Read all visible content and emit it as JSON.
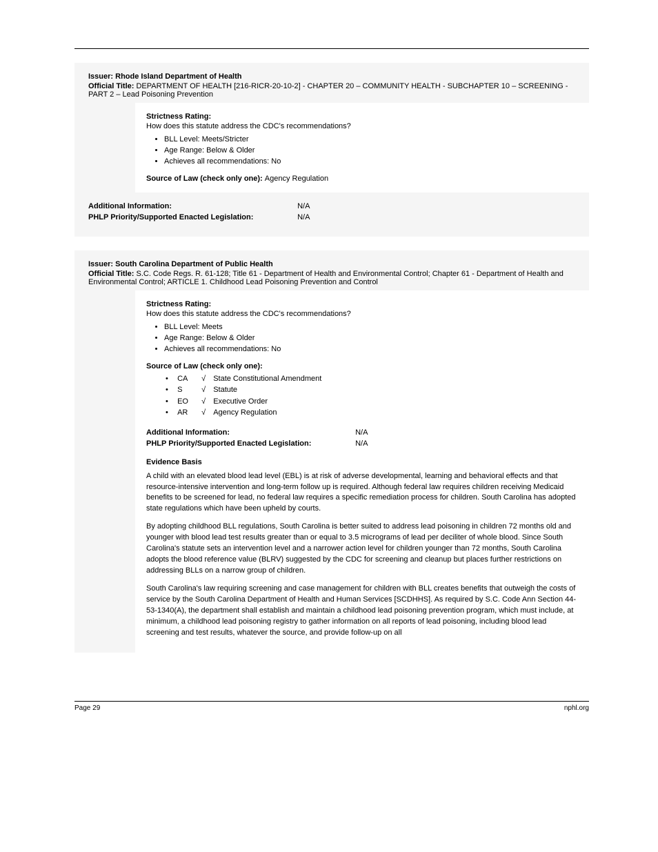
{
  "box1": {
    "issuer_label": "Issuer:",
    "issuer": "Rhode Island Department of Health",
    "title_label": "Official Title:",
    "title": "DEPARTMENT OF HEALTH [216-RICR-20-10-2] - CHAPTER 20 – COMMUNITY HEALTH - SUBCHAPTER 10 – SCREENING - PART 2 – Lead Poisoning Prevention",
    "rating_label": "Strictness Rating:",
    "rating_sub": "How does this statute address the CDC's recommendations?",
    "bullets": [
      "BLL Level: Meets/Stricter",
      "Age Range: Below & Older",
      "Achieves all recommendations: No"
    ],
    "source_label": "Source of Law (check only one):",
    "source_value": "Agency Regulation",
    "info_label": "Additional Information:",
    "info_value": "N/A",
    "act_label": "PHLP Priority/Supported Enacted Legislation:",
    "act_value": "N/A"
  },
  "box2": {
    "issuer_label": "Issuer:",
    "issuer": "South Carolina Department of Public Health",
    "title_label": "Official Title:",
    "title": "S.C. Code Regs. R. 61-128; Title 61 - Department of Health and Environmental Control; Chapter 61 - Department of Health and Environmental Control; ARTICLE 1. Childhood Lead Poisoning Prevention and Control",
    "rating_label": "Strictness Rating:",
    "rating_sub": "How does this statute address the CDC's recommendations?",
    "bullets": [
      "BLL Level: Meets",
      "Age Range: Below & Older",
      "Achieves all recommendations: No"
    ],
    "source_label": "Source of Law (check only one):",
    "sources": [
      {
        "code": "CA",
        "check": "√",
        "name": "State Constitutional Amendment"
      },
      {
        "code": "S",
        "check": "√",
        "name": "Statute"
      },
      {
        "code": "EO",
        "check": "√",
        "name": "Executive Order"
      },
      {
        "code": "AR",
        "check": "√",
        "name": "Agency Regulation"
      }
    ],
    "info_label": "Additional Information:",
    "info_value": "N/A",
    "act_label": "PHLP Priority/Supported Enacted Legislation:",
    "act_value": "N/A",
    "ev_title": "Evidence Basis",
    "ev_p1": "A child with an elevated blood lead level (EBL) is at risk of adverse developmental, learning and behavioral effects and that resource-intensive intervention and long-term follow up is required. Although federal law requires children receiving Medicaid benefits to be screened for lead, no federal law requires a specific remediation process for children. South Carolina has adopted state regulations which have been upheld by courts.",
    "ev_p2": "By adopting childhood BLL regulations, South Carolina is better suited to address lead poisoning in children 72 months old and younger with blood lead test results greater than or equal to 3.5 micrograms of lead per deciliter of whole blood. Since South Carolina's statute sets an intervention level and a narrower action level for children younger than 72 months, South Carolina adopts the blood reference value (BLRV) suggested by the CDC for screening and cleanup but places further restrictions on addressing BLLs on a narrow group of children.",
    "ev_p3": "South Carolina's law requiring screening and case management for children with BLL creates benefits that outweigh the costs of service by the South Carolina Department of Health and Human Services [SCDHHS]. As required by S.C. Code Ann Section 44-53-1340(A), the department shall establish and maintain a childhood lead poisoning prevention program, which must include, at minimum, a childhood lead poisoning registry to gather information on all reports of lead poisoning, including blood lead screening and test results, whatever the source, and provide follow-up on all"
  },
  "footer": {
    "left": "Page 29",
    "right": "nphl.org"
  }
}
